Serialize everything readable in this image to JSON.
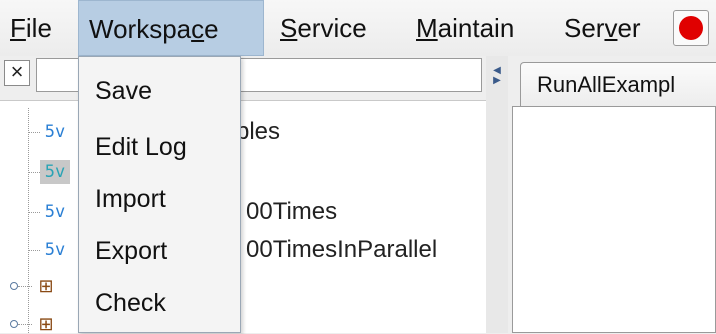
{
  "menubar": {
    "items": [
      {
        "label": "File",
        "mnemonic": "F",
        "rest": "ile"
      },
      {
        "label": "Workspace",
        "pre": "Workspa",
        "mnemonic": "c",
        "rest": "e"
      },
      {
        "label": "Service",
        "mnemonic": "S",
        "rest": "ervice"
      },
      {
        "label": "Maintain",
        "mnemonic": "M",
        "rest": "aintain"
      },
      {
        "label": "Server",
        "pre": "Ser",
        "mnemonic": "v",
        "rest": "er"
      }
    ],
    "active_menu": "Workspace",
    "stop_color": "#e00000"
  },
  "search": {
    "clear_label": "×",
    "value": ""
  },
  "tree": {
    "sv_glyph": "5v",
    "rows": [
      {
        "text": "ples"
      },
      {
        "text": ""
      },
      {
        "text": "00Times"
      },
      {
        "text": "00TimesInParallel"
      }
    ]
  },
  "tabs": [
    {
      "label": "RunAllExampl"
    }
  ],
  "workspace_menu": {
    "items": [
      {
        "label": "Save"
      },
      {
        "label": "Edit Log"
      },
      {
        "label": "Import"
      },
      {
        "label": "Export"
      },
      {
        "label": "Check"
      }
    ]
  }
}
